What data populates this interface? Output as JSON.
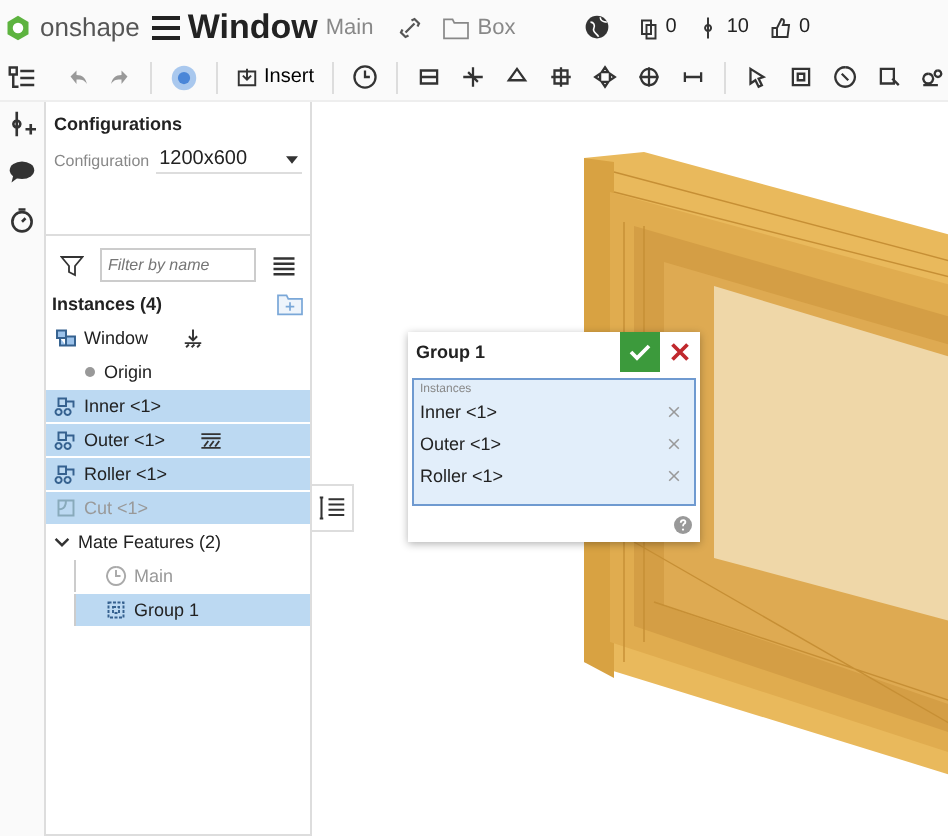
{
  "app": {
    "brand": "onshape",
    "document": "Window",
    "workspace": "Main",
    "folder": "Box"
  },
  "stats": [
    {
      "kind": "copies",
      "value": "0"
    },
    {
      "kind": "versions",
      "value": "10"
    },
    {
      "kind": "likes",
      "value": "0"
    }
  ],
  "toolbar": {
    "insert": "Insert"
  },
  "configurations": {
    "title": "Configurations",
    "label": "Configuration",
    "value": "1200x600"
  },
  "filter": {
    "placeholder": "Filter by name"
  },
  "instances": {
    "title": "Instances (4)",
    "items": [
      {
        "label": "Window",
        "kind": "assembly",
        "fixed": true,
        "grounded": false,
        "selected": false,
        "disabled": false
      },
      {
        "label": "Origin",
        "kind": "origin",
        "fixed": false,
        "grounded": false,
        "selected": false,
        "disabled": false
      },
      {
        "label": "Inner <1>",
        "kind": "part",
        "fixed": false,
        "grounded": false,
        "selected": true,
        "disabled": false
      },
      {
        "label": "Outer <1>",
        "kind": "part",
        "fixed": false,
        "grounded": true,
        "selected": true,
        "disabled": false
      },
      {
        "label": "Roller <1>",
        "kind": "part",
        "fixed": false,
        "grounded": false,
        "selected": true,
        "disabled": false
      },
      {
        "label": "Cut <1>",
        "kind": "sketch",
        "fixed": false,
        "grounded": false,
        "selected": true,
        "disabled": true
      }
    ]
  },
  "mate_features": {
    "title": "Mate Features (2)",
    "expanded": true,
    "items": [
      {
        "label": "Main",
        "kind": "mate",
        "selected": false,
        "disabled": true
      },
      {
        "label": "Group 1",
        "kind": "group",
        "selected": true,
        "disabled": false
      }
    ]
  },
  "dialog": {
    "title": "Group 1",
    "field_label": "Instances",
    "items": [
      "Inner <1>",
      "Outer <1>",
      "Roller <1>"
    ]
  }
}
